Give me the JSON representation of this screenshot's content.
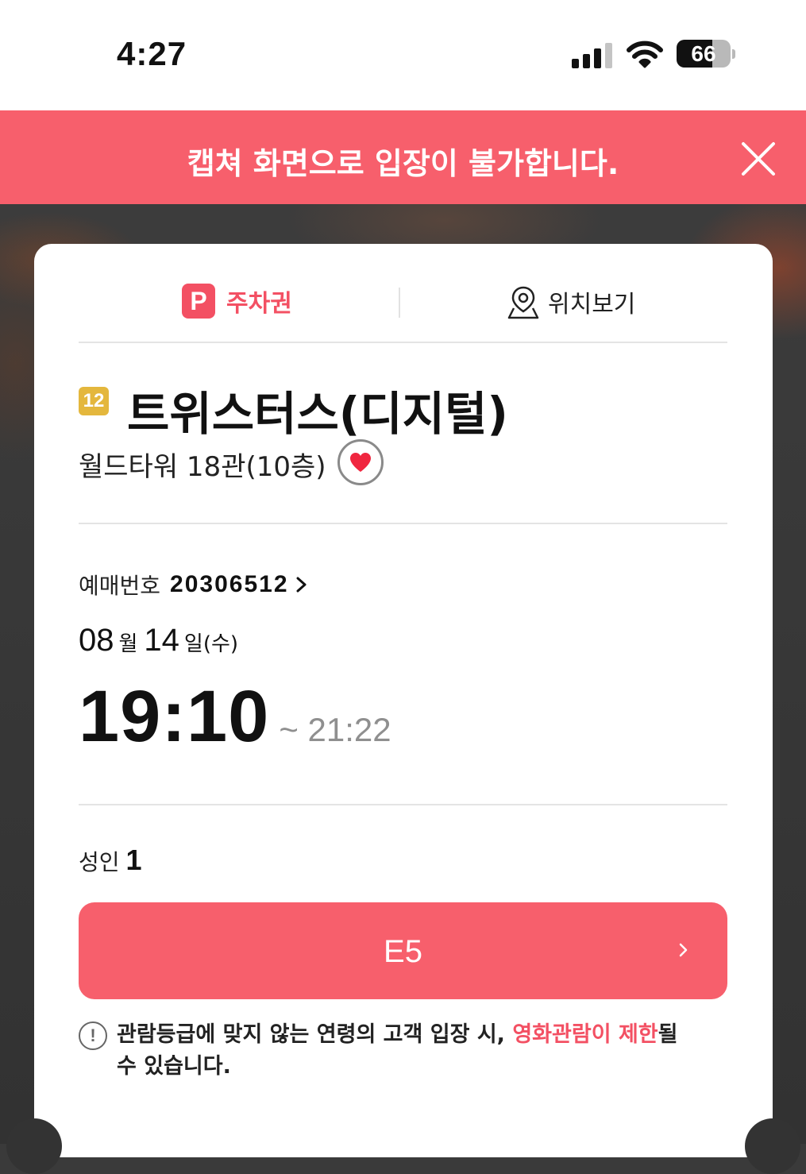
{
  "status_bar": {
    "time": "4:27",
    "battery": "66",
    "battery_level": 0.66
  },
  "banner": {
    "message": "캡쳐 화면으로 입장이 불가합니다.",
    "close_icon": "close-icon"
  },
  "tabs": {
    "parking": {
      "badge": "P",
      "label": "주차권"
    },
    "location": {
      "label": "위치보기",
      "icon": "map-pin-icon"
    }
  },
  "movie": {
    "rating": "12",
    "title": "트위스터스(디지털)",
    "theater": "월드타워 18관(10층)"
  },
  "booking": {
    "label": "예매번호",
    "number": "20306512"
  },
  "date": {
    "month": "08",
    "month_unit": "월",
    "day": "14",
    "day_unit": "일(수)"
  },
  "time": {
    "start": "19:10",
    "end": "~ 21:22"
  },
  "audience": {
    "label": "성인",
    "count": "1"
  },
  "seat": {
    "label": "E5"
  },
  "notice": {
    "text_before": "관람등급에 맞지 않는 연령의 고객 입장 시, ",
    "highlight": "영화관람이 제한",
    "text_after": "될 수 있습니다."
  },
  "colors": {
    "accent": "#f75f6c",
    "accent_text": "#f35063",
    "rating_badge": "#e4b73d"
  }
}
